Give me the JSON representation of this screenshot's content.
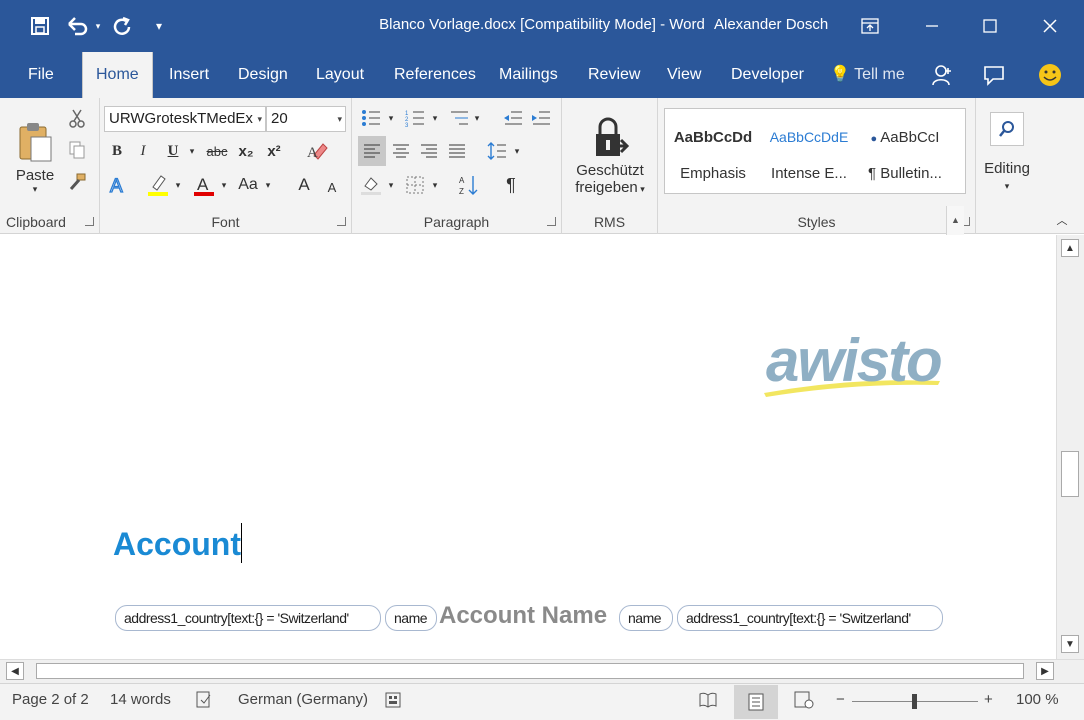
{
  "window": {
    "title": "Blanco Vorlage.docx [Compatibility Mode]  -  Word",
    "user": "Alexander Dosch",
    "accent": "#2b579a"
  },
  "tabs": [
    "File",
    "Home",
    "Insert",
    "Design",
    "Layout",
    "References",
    "Mailings",
    "Review",
    "View",
    "Developer"
  ],
  "tell_me": "Tell me",
  "ribbon": {
    "clipboard": {
      "paste": "Paste",
      "label": "Clipboard"
    },
    "font": {
      "name": "URWGroteskTMedEx",
      "size": "20",
      "label": "Font",
      "bold": "B",
      "italic": "I",
      "underline": "U",
      "strike": "abc",
      "sub": "x₂",
      "sup": "x²",
      "case": "Aa",
      "grow": "A",
      "shrink": "A",
      "highlight_color": "#ffff00",
      "font_color": "#e00000"
    },
    "paragraph": {
      "label": "Paragraph",
      "pilcrow": "¶"
    },
    "rms": {
      "line1": "Geschützt",
      "line2": "freigeben",
      "label": "RMS"
    },
    "styles": {
      "label": "Styles",
      "items": [
        {
          "preview": "AaBbCcDd",
          "name": "Emphasis"
        },
        {
          "preview": "AaBbCcDdE",
          "name": "Intense E..."
        },
        {
          "preview": "AaBbCcI",
          "name": "¶ Bulletin..."
        }
      ]
    },
    "editing": {
      "label": "Editing"
    }
  },
  "document": {
    "logo_text": "awisto",
    "heading": "Account",
    "controls": {
      "cc1": "address1_country[text:{} = 'Switzerland'",
      "cc2": "name",
      "account_name": "Account Name",
      "cc3": "name",
      "cc4": "address1_country[text:{} = 'Switzerland'"
    }
  },
  "status": {
    "page": "Page 2 of 2",
    "words": "14 words",
    "language": "German (Germany)",
    "zoom": "100 %"
  }
}
